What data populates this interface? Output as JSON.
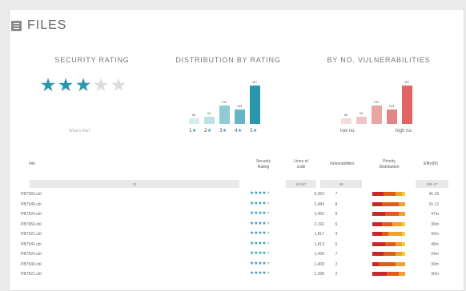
{
  "header": {
    "title": "FILES",
    "icon": "list-icon"
  },
  "security": {
    "heading": "SECURITY RATING",
    "rating": 3,
    "max": 5,
    "whats_link": "What's this?",
    "color_on": "#2a97ad",
    "color_off": "#dddddd"
  },
  "distribution": {
    "heading": "DISTRIBUTION BY RATING",
    "labels": [
      "1",
      "2",
      "3",
      "4",
      "5"
    ],
    "values": [
      "68",
      "95",
      "232",
      "185",
      "487"
    ],
    "colors": [
      "#d6ecef",
      "#bfe0e6",
      "#8fcad5",
      "#64b6c5",
      "#2a97ad"
    ]
  },
  "vulnerabilities": {
    "heading": "BY NO. VULNERABILITIES",
    "low_label": "low no.",
    "high_label": "high no.",
    "values": [
      "68",
      "95",
      "232",
      "185",
      "487"
    ],
    "colors": [
      "#f4dcdc",
      "#f0c4c4",
      "#eaa5a5",
      "#e48585",
      "#e16565"
    ]
  },
  "table": {
    "headers": {
      "file": "File",
      "security": "Security\nRating",
      "loc": "Lines of\ncode",
      "vuln": "Vulnerabilities",
      "priority": "Priority\nDistribution",
      "effort": "Effort[h]"
    },
    "summary": {
      "files": "21",
      "loc": "34,547",
      "vuln": "58",
      "effort": "19h 47"
    },
    "rows": [
      {
        "file": "PB7960.cbl",
        "rating": 4,
        "loc": "9,253",
        "vuln": "7",
        "effort": "4h 18"
      },
      {
        "file": "PB7940.cbl",
        "rating": 4,
        "loc": "2,484",
        "vuln": "8",
        "effort": "1h 12"
      },
      {
        "file": "PB7824.cbl",
        "rating": 4,
        "loc": "2,460",
        "vuln": "8",
        "effort": "47m"
      },
      {
        "file": "PB7950.cbl",
        "rating": 4,
        "loc": "2,192",
        "vuln": "6",
        "effort": "36m"
      },
      {
        "file": "PB7921.cbl",
        "rating": 4,
        "loc": "1,817",
        "vuln": "4",
        "effort": "42m"
      },
      {
        "file": "PB7941.cbl",
        "rating": 4,
        "loc": "1,813",
        "vuln": "5",
        "effort": "48m"
      },
      {
        "file": "PB7824.cbl",
        "rating": 4,
        "loc": "1,439",
        "vuln": "7",
        "effort": "24m"
      },
      {
        "file": "PB7940.cbl",
        "rating": 4,
        "loc": "1,409",
        "vuln": "2",
        "effort": "30m"
      },
      {
        "file": "PB7821.cbl",
        "rating": 4,
        "loc": "1,398",
        "vuln": "2",
        "effort": "30m"
      }
    ],
    "priority_colors": [
      "#c62828",
      "#e05a1a",
      "#f0a030",
      "#f5d020"
    ]
  }
}
